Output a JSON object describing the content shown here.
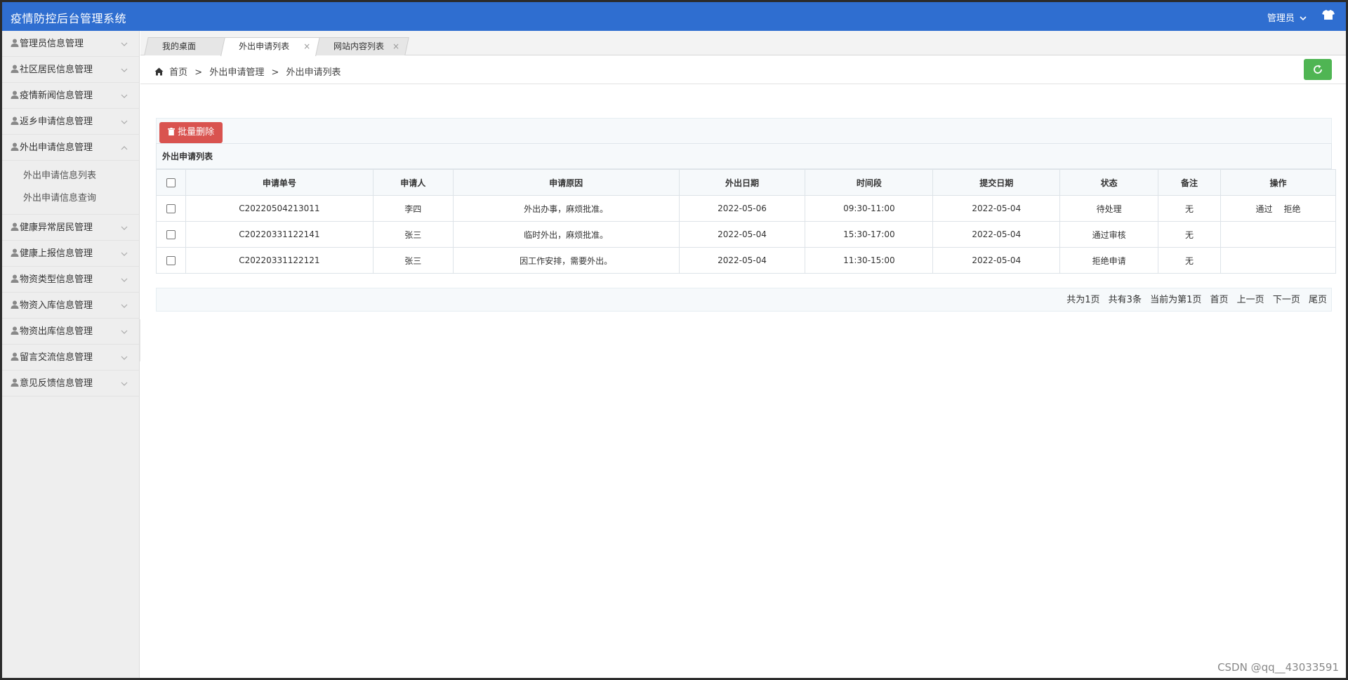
{
  "app": {
    "title": "疫情防控后台管理系统",
    "user_label": "管理员"
  },
  "sidebar": {
    "items": [
      {
        "label": "管理员信息管理"
      },
      {
        "label": "社区居民信息管理"
      },
      {
        "label": "疫情新闻信息管理"
      },
      {
        "label": "返乡申请信息管理"
      },
      {
        "label": "外出申请信息管理",
        "expanded": true,
        "children": [
          {
            "label": "外出申请信息列表"
          },
          {
            "label": "外出申请信息查询"
          }
        ]
      },
      {
        "label": "健康异常居民管理"
      },
      {
        "label": "健康上报信息管理"
      },
      {
        "label": "物资类型信息管理"
      },
      {
        "label": "物资入库信息管理"
      },
      {
        "label": "物资出库信息管理"
      },
      {
        "label": "留言交流信息管理"
      },
      {
        "label": "意见反馈信息管理"
      }
    ]
  },
  "tabs": [
    {
      "label": "我的桌面"
    },
    {
      "label": "外出申请列表",
      "active": true,
      "close": "×"
    },
    {
      "label": "网站内容列表",
      "close": "×"
    }
  ],
  "breadcrumb": {
    "home": "首页",
    "sep": ">",
    "level1": "外出申请管理",
    "level2": "外出申请列表"
  },
  "toolbar": {
    "batch_delete": "批量删除"
  },
  "panel": {
    "title": "外出申请列表"
  },
  "table": {
    "headers": [
      "申请单号",
      "申请人",
      "申请原因",
      "外出日期",
      "时间段",
      "提交日期",
      "状态",
      "备注",
      "操作"
    ],
    "rows": [
      {
        "id": "C20220504213011",
        "applicant": "李四",
        "reason": "外出办事，麻烦批准。",
        "out_date": "2022-05-06",
        "period": "09:30-11:00",
        "submit_date": "2022-05-04",
        "status": "待处理",
        "remark": "无",
        "ops": [
          "通过",
          "拒绝"
        ]
      },
      {
        "id": "C20220331122141",
        "applicant": "张三",
        "reason": "临时外出，麻烦批准。",
        "out_date": "2022-05-04",
        "period": "15:30-17:00",
        "submit_date": "2022-05-04",
        "status": "通过审核",
        "remark": "无",
        "ops": []
      },
      {
        "id": "C20220331122121",
        "applicant": "张三",
        "reason": "因工作安排，需要外出。",
        "out_date": "2022-05-04",
        "period": "11:30-15:00",
        "submit_date": "2022-05-04",
        "status": "拒绝申请",
        "remark": "无",
        "ops": []
      }
    ]
  },
  "pager": {
    "total_pages": "共为1页",
    "total_items": "共有3条",
    "current": "当前为第1页",
    "first": "首页",
    "prev": "上一页",
    "next": "下一页",
    "last": "尾页"
  },
  "watermark": "CSDN @qq__43033591",
  "colors": {
    "header": "#2f6ed0",
    "danger": "#d9534f",
    "success": "#4fb553"
  }
}
